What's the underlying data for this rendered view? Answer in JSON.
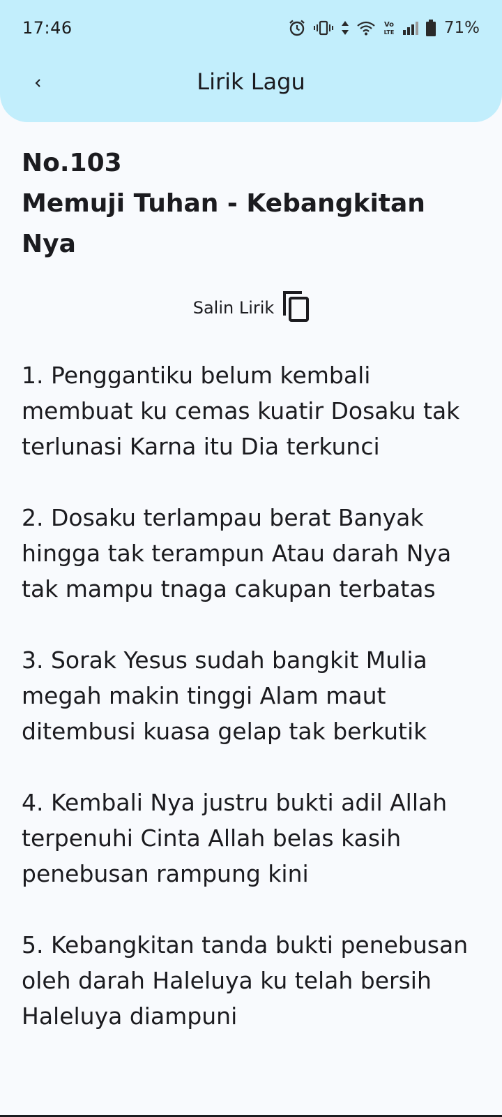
{
  "status_bar": {
    "time": "17:46",
    "battery_percent": "71%",
    "icons": [
      "alarm-icon",
      "vibrate-icon",
      "data-arrows-icon",
      "wifi-icon",
      "volte-icon",
      "signal-icon",
      "battery-icon"
    ]
  },
  "appbar": {
    "back_icon": "chevron-left-icon",
    "title": "Lirik Lagu",
    "background": "#c2eefc"
  },
  "song": {
    "number": "No.103",
    "title": "Memuji Tuhan - Kebangkitan Nya"
  },
  "copy": {
    "label": "Salin Lirik",
    "icon": "copy-icon"
  },
  "verses": [
    "1.  Penggantiku belum kembali membuat ku cemas kuatir Dosaku tak terlunasi Karna itu Dia terkunci",
    "2.  Dosaku terlampau berat Banyak hingga tak terampun Atau darah Nya tak mampu tnaga cakupan terbatas",
    "3.  Sorak Yesus sudah bangkit Mulia megah makin tinggi Alam maut ditembusi kuasa gelap tak berkutik",
    "4.  Kembali Nya justru bukti adil Allah terpenuhi Cinta Allah belas kasih penebusan rampung kini",
    "5.  Kebangkitan tanda bukti penebusan oleh darah Haleluya ku telah bersih Haleluya diampuni"
  ]
}
